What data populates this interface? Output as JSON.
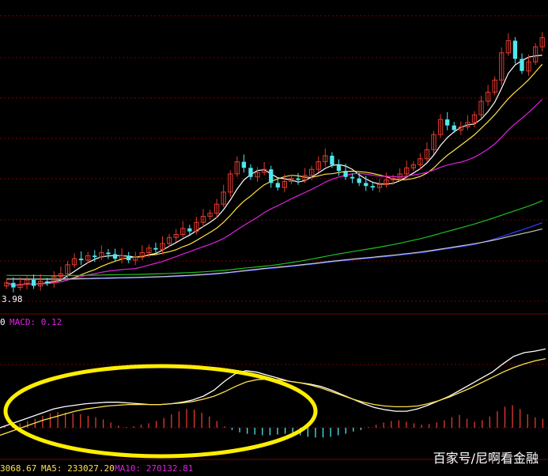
{
  "colors": {
    "background": "#000000",
    "grid": "#7a0000",
    "up": "#e23b2e",
    "down": "#4ee8ee",
    "ma_white": "#ffffff",
    "ma_yellow": "#ffe14a",
    "ma_magenta": "#e020e0",
    "ma_green": "#20c020",
    "ma_blue": "#3040ff",
    "ma_gray": "#c8c8c8",
    "highlight": "#ffee00",
    "label_macd": "#e020e0",
    "label_yellow": "#ffe14a",
    "label_red": "#ff3030"
  },
  "labels": {
    "price_low": "3.98",
    "macd_prefix": "0",
    "macd": "MACD: 0.12",
    "vol_value": "3068.67",
    "vol_ma5": "MA5: 233027.20",
    "vol_ma10": "MA10: 270132.81"
  },
  "watermark": "百家号/尼啊看金融",
  "chart_data": [
    {
      "type": "candlestick",
      "title": "",
      "price_range": [
        3.98,
        12.6
      ],
      "min_label": "3.98",
      "moving_averages": [
        "white",
        "yellow",
        "magenta",
        "green",
        "blue",
        "gray"
      ],
      "closes": [
        4.3,
        4.15,
        4.25,
        4.4,
        4.2,
        4.35,
        4.3,
        4.5,
        4.6,
        4.9,
        5.1,
        5.05,
        5.2,
        5.15,
        5.3,
        5.25,
        5.1,
        5.2,
        5.05,
        5.15,
        5.3,
        5.45,
        5.4,
        5.6,
        5.8,
        5.9,
        6.1,
        6.0,
        6.3,
        6.5,
        6.6,
        6.9,
        7.3,
        7.9,
        8.3,
        8.1,
        7.8,
        7.95,
        8.05,
        7.6,
        7.45,
        7.65,
        7.75,
        7.7,
        7.85,
        8.05,
        8.3,
        8.5,
        8.2,
        8.0,
        7.8,
        7.75,
        7.6,
        7.5,
        7.45,
        7.55,
        7.7,
        7.75,
        7.9,
        8.1,
        8.2,
        8.4,
        8.7,
        9.2,
        9.7,
        9.5,
        9.35,
        9.45,
        9.6,
        9.85,
        10.3,
        10.6,
        11.0,
        11.9,
        12.3,
        11.7,
        11.3,
        11.6,
        12.1,
        12.4
      ],
      "opens": [
        4.2,
        4.3,
        4.15,
        4.25,
        4.4,
        4.2,
        4.35,
        4.3,
        4.5,
        4.6,
        4.9,
        5.1,
        5.05,
        5.2,
        5.15,
        5.3,
        5.25,
        5.1,
        5.2,
        5.05,
        5.15,
        5.3,
        5.45,
        5.4,
        5.6,
        5.8,
        5.9,
        6.1,
        6.0,
        6.3,
        6.5,
        6.6,
        6.9,
        7.3,
        7.9,
        8.3,
        8.1,
        7.8,
        7.95,
        8.05,
        7.6,
        7.45,
        7.65,
        7.75,
        7.7,
        7.85,
        8.05,
        8.3,
        8.5,
        8.2,
        8.0,
        7.8,
        7.75,
        7.6,
        7.5,
        7.45,
        7.55,
        7.7,
        7.75,
        7.9,
        8.1,
        8.2,
        8.4,
        8.7,
        9.2,
        9.7,
        9.5,
        9.35,
        9.45,
        9.6,
        9.85,
        10.3,
        10.6,
        11.0,
        11.9,
        12.3,
        11.7,
        11.3,
        11.6,
        12.1
      ]
    },
    {
      "type": "bar",
      "title": "",
      "series": [
        {
          "name": "MACD",
          "values": [
            0.02,
            0.04,
            0.06,
            0.09,
            0.12,
            0.16,
            0.19,
            0.21,
            0.2,
            0.19,
            0.18,
            0.16,
            0.14,
            0.11,
            0.07,
            0.03,
            0.01,
            0.02,
            0.04,
            0.06,
            0.09,
            0.13,
            0.18,
            0.22,
            0.25,
            0.24,
            0.2,
            0.15,
            0.09,
            0.02,
            -0.03,
            -0.06,
            -0.08,
            -0.09,
            -0.1,
            -0.1,
            -0.09,
            -0.08,
            -0.08,
            -0.1,
            -0.12,
            -0.13,
            -0.13,
            -0.12,
            -0.1,
            -0.08,
            -0.05,
            -0.03,
            0.01,
            0.04,
            0.07,
            0.09,
            0.1,
            0.08,
            0.06,
            0.04,
            0.05,
            0.07,
            0.1,
            0.14,
            0.17,
            0.12,
            0.08,
            0.1,
            0.15,
            0.22,
            0.28,
            0.3,
            0.25,
            0.18,
            0.14,
            0.12
          ]
        },
        {
          "name": "DIF",
          "values": [
            0.0,
            0.05,
            0.1,
            0.15,
            0.2,
            0.25,
            0.28,
            0.3,
            0.32,
            0.33,
            0.34,
            0.34,
            0.33,
            0.32,
            0.31,
            0.31,
            0.32,
            0.34,
            0.37,
            0.42,
            0.5,
            0.62,
            0.72,
            0.76,
            0.74,
            0.7,
            0.66,
            0.62,
            0.6,
            0.58,
            0.55,
            0.5,
            0.44,
            0.38,
            0.32,
            0.27,
            0.24,
            0.22,
            0.22,
            0.25,
            0.3,
            0.36,
            0.42,
            0.5,
            0.58,
            0.66,
            0.74,
            0.85,
            0.95,
            1.0,
            1.02,
            1.05
          ]
        },
        {
          "name": "DEA",
          "values": [
            -0.1,
            -0.05,
            0.0,
            0.05,
            0.1,
            0.14,
            0.18,
            0.22,
            0.25,
            0.27,
            0.29,
            0.3,
            0.31,
            0.31,
            0.31,
            0.31,
            0.32,
            0.33,
            0.35,
            0.38,
            0.42,
            0.48,
            0.55,
            0.61,
            0.64,
            0.65,
            0.64,
            0.62,
            0.6,
            0.57,
            0.53,
            0.48,
            0.43,
            0.38,
            0.34,
            0.31,
            0.29,
            0.28,
            0.28,
            0.29,
            0.32,
            0.36,
            0.41,
            0.47,
            0.53,
            0.6,
            0.67,
            0.74,
            0.8,
            0.85,
            0.89,
            0.92
          ]
        }
      ]
    }
  ]
}
